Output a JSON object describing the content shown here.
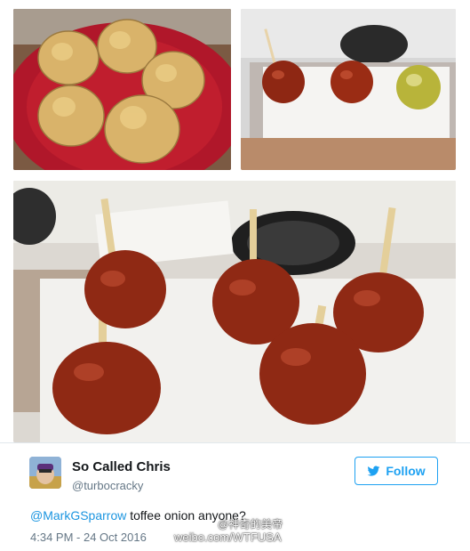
{
  "tweet": {
    "display_name": "So Called Chris",
    "handle": "@turbocracky",
    "follow_label": "Follow",
    "mention": "@MarkGSparrow",
    "body_text": " toffee onion anyone?",
    "timestamp": "4:34 PM - 24 Oct 2016"
  },
  "watermark": {
    "line1": "@神奇的美帝",
    "line2": "weibo.com/WTFUSA"
  },
  "photos": [
    {
      "subject": "six yellow onions on a red plate"
    },
    {
      "subject": "two toffee-coated onions and one raw onion on foil"
    },
    {
      "subject": "five toffee onions on sticks on parchment by a stove"
    }
  ],
  "colors": {
    "accent": "#1da1f2",
    "mention": "#1b95e0",
    "text": "#14171a",
    "muted": "#657786",
    "toffee": "#8c2a12"
  },
  "icons": {
    "follow": "twitter-bird-icon",
    "avatar": "user-avatar"
  }
}
